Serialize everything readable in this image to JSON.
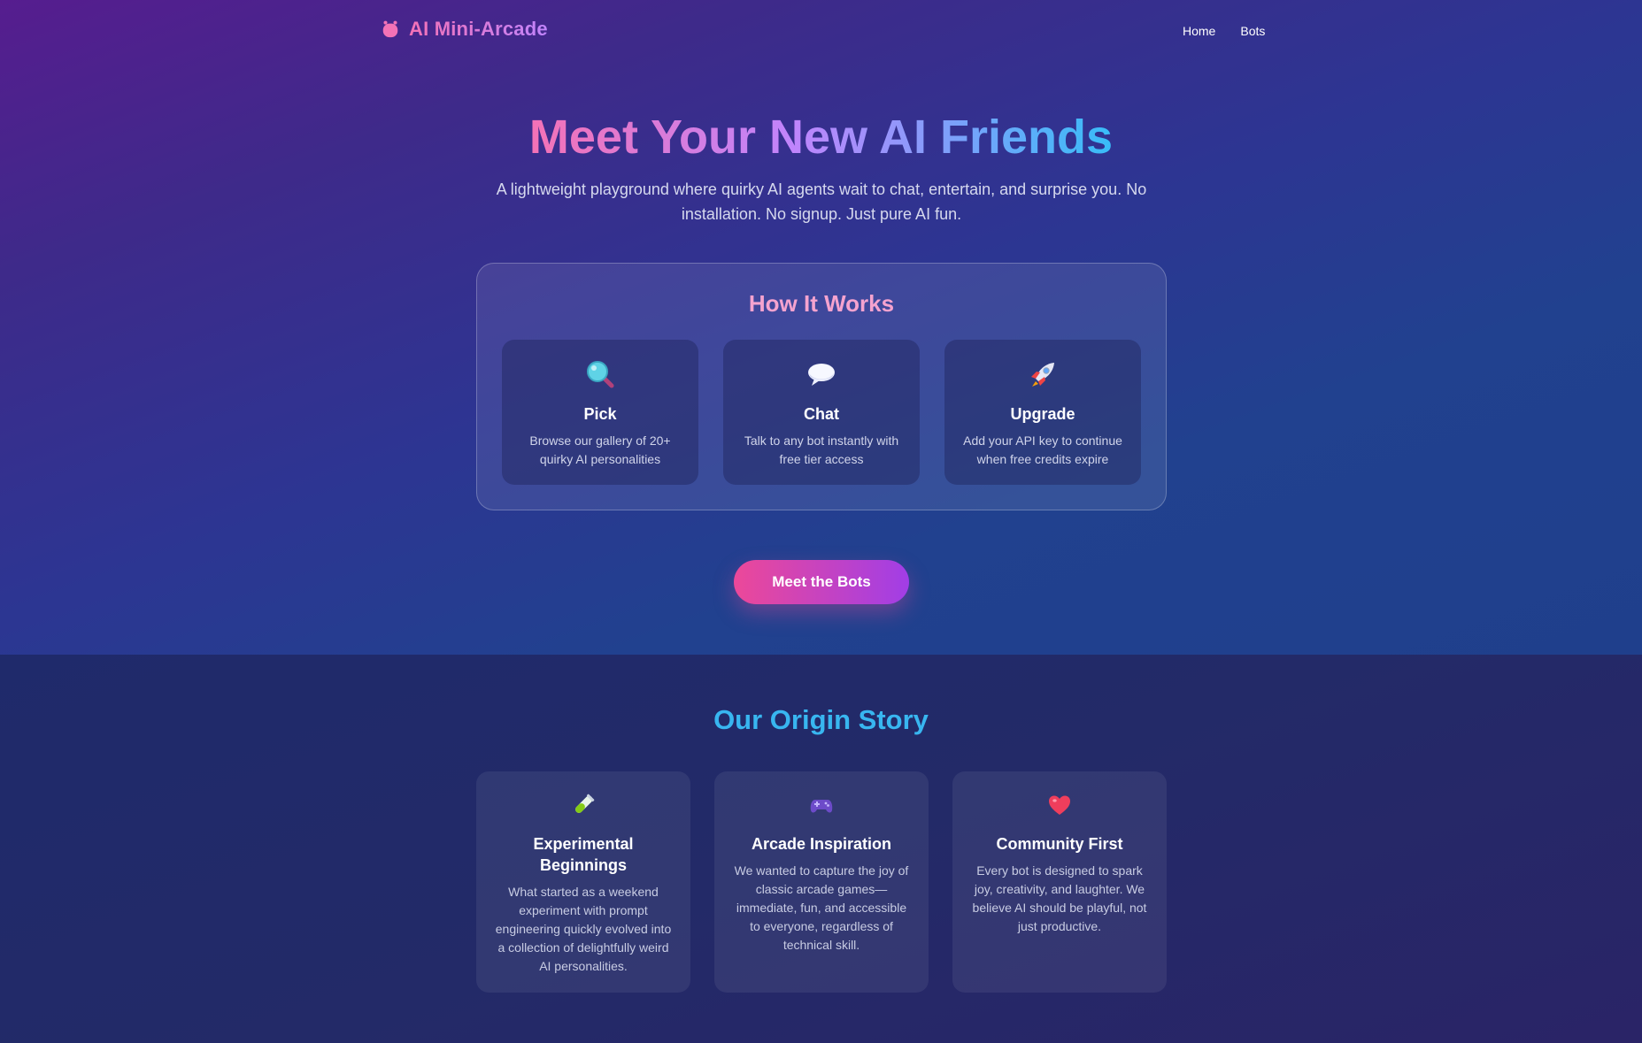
{
  "nav": {
    "brand_icon": "robot-icon",
    "brand_name": "AI Mini-Arcade",
    "links": [
      "Home",
      "Bots"
    ]
  },
  "hero": {
    "title": "Meet Your New AI Friends",
    "subtitle": "A lightweight playground where quirky AI agents wait to chat, entertain, and surprise you. No installation. No signup. Just pure AI fun.",
    "cta_label": "Meet the Bots"
  },
  "how_it_works": {
    "title": "How It Works",
    "steps": [
      {
        "icon": "magnifier-icon",
        "title": "Pick",
        "text": "Browse our gallery of 20+ quirky AI personalities"
      },
      {
        "icon": "speech-bubble-icon",
        "title": "Chat",
        "text": "Talk to any bot instantly with free tier access"
      },
      {
        "icon": "rocket-icon",
        "title": "Upgrade",
        "text": "Add your API key to continue when free credits expire"
      }
    ]
  },
  "origin": {
    "title": "Our Origin Story",
    "cards": [
      {
        "icon": "test-tube-icon",
        "title": "Experimental Beginnings",
        "text": "What started as a weekend experiment with prompt engineering quickly evolved into a collection of delightfully weird AI personalities."
      },
      {
        "icon": "game-controller-icon",
        "title": "Arcade Inspiration",
        "text": "We wanted to capture the joy of classic arcade games—immediate, fun, and accessible to everyone, regardless of technical skill."
      },
      {
        "icon": "heart-icon",
        "title": "Community First",
        "text": "Every bot is designed to spark joy, creativity, and laughter. We believe AI should be playful, not just productive."
      }
    ]
  },
  "colors": {
    "accent_pink": "#ec4899",
    "accent_purple": "#a13ee6",
    "accent_blue": "#38b6f0",
    "how_title": "#f5a3cf"
  }
}
